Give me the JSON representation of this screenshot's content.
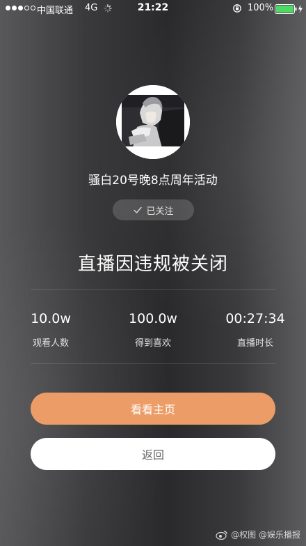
{
  "status_bar": {
    "carrier": "中国联通",
    "network": "4G",
    "time": "21:22",
    "battery": "100%",
    "signal_bars_filled": 3,
    "signal_bars_total": 5
  },
  "profile": {
    "name": "骚白20号晚8点周年活动",
    "follow_label": "已关注"
  },
  "headline": "直播因违规被关闭",
  "stats": {
    "viewers": {
      "value": "10.0w",
      "label": "观看人数"
    },
    "likes": {
      "value": "100.0w",
      "label": "得到喜欢"
    },
    "duration": {
      "value": "00:27:34",
      "label": "直播时长"
    }
  },
  "buttons": {
    "visit_home": "看看主页",
    "back": "返回"
  },
  "watermark": {
    "text": "@权图 @娱乐播报"
  },
  "colors": {
    "primary_button": "#ec9d67",
    "secondary_button": "#ffffff",
    "battery_fill": "#4cd964"
  }
}
